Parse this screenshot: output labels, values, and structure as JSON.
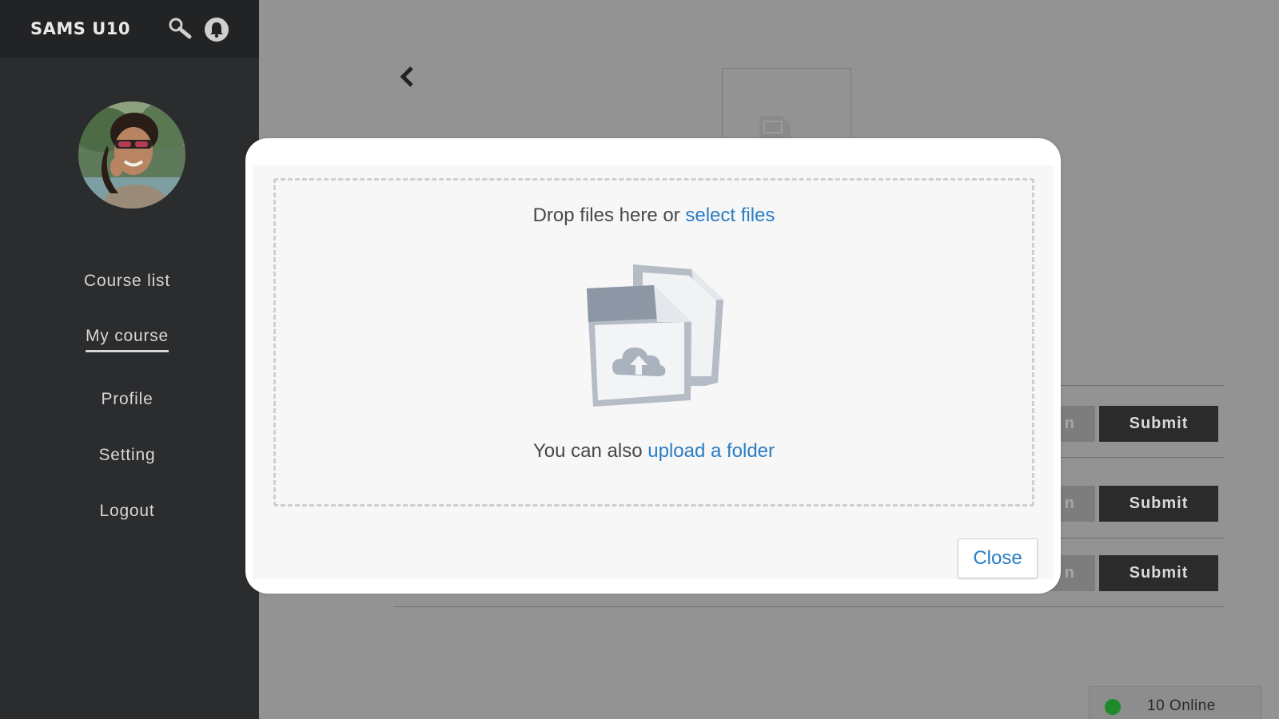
{
  "header": {
    "brand": "SAMS U10",
    "search_icon": "search-icon",
    "notification_icon": "bell-icon"
  },
  "sidebar": {
    "avatar_icon": "user-avatar",
    "items": [
      {
        "label": "Course list",
        "active": false
      },
      {
        "label": "My course",
        "active": true
      },
      {
        "label": "Profile",
        "active": false
      },
      {
        "label": "Setting",
        "active": false
      },
      {
        "label": "Logout",
        "active": false
      }
    ]
  },
  "main": {
    "back_icon": "chevron-left-icon",
    "image_placeholder_icon": "image-placeholder-icon",
    "rows": [
      {
        "partial_button_label": "n",
        "submit_label": "Submit"
      },
      {
        "partial_button_label": "n",
        "submit_label": "Submit"
      },
      {
        "partial_button_label": "n",
        "submit_label": "Submit"
      }
    ]
  },
  "status": {
    "online_label": "10 Online",
    "online_color": "#1e8a2a"
  },
  "upload_modal": {
    "drop_prefix": "Drop files here or ",
    "select_files_link": "select files",
    "folder_prefix": "You can also ",
    "upload_folder_link": "upload a folder",
    "files_icon": "cloud-upload-files-icon",
    "close_label": "Close",
    "link_color": "#2a7cc4"
  }
}
